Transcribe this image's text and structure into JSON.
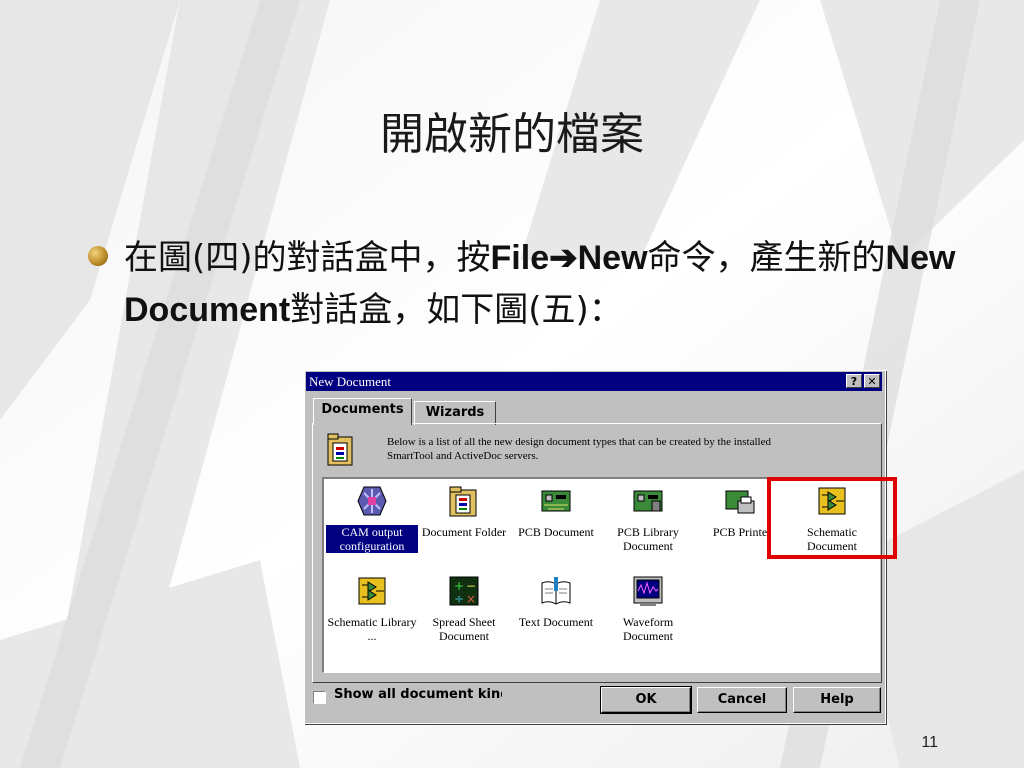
{
  "slide": {
    "title": "開啟新的檔案",
    "bullet": {
      "part1": "在圖(",
      "part2": "四",
      "part3": ")的對話盒中，按",
      "file": "File",
      "arrow": "➔",
      "new": "New",
      "part4": "命令，產生新的",
      "newdoc": "New Document",
      "part5": "對話盒，如下圖(",
      "part6": "五",
      "part7": ")："
    },
    "page_number": "11"
  },
  "dialog": {
    "title": "New Document",
    "help_button": "?",
    "close_button": "✕",
    "tabs": [
      "Documents",
      "Wizards"
    ],
    "description": "Below is a list of all the new design document types that can be created by the installed SmartTool and ActiveDoc servers.",
    "items": [
      {
        "label": "CAM output configuration",
        "icon": "cam-output-icon",
        "selected": true
      },
      {
        "label": "Document Folder",
        "icon": "document-folder-icon",
        "selected": false
      },
      {
        "label": "PCB Document",
        "icon": "pcb-document-icon",
        "selected": false
      },
      {
        "label": "PCB Library Document",
        "icon": "pcb-library-icon",
        "selected": false
      },
      {
        "label": "PCB Printe",
        "icon": "pcb-printer-icon",
        "selected": false
      },
      {
        "label": "Schematic Document",
        "icon": "schematic-document-icon",
        "selected": false
      },
      {
        "label": "Schematic Library ...",
        "icon": "schematic-library-icon",
        "selected": false
      },
      {
        "label": "Spread Sheet Document",
        "icon": "spreadsheet-icon",
        "selected": false
      },
      {
        "label": "Text Document",
        "icon": "text-document-icon",
        "selected": false
      },
      {
        "label": "Waveform Document",
        "icon": "waveform-icon",
        "selected": false
      }
    ],
    "checkbox_label": "Show all document kinds",
    "checkbox_checked": false,
    "buttons": {
      "ok": "OK",
      "cancel": "Cancel",
      "help": "Help"
    }
  },
  "colors": {
    "titlebar": "#000080",
    "dialog_face": "#c0c0c0",
    "highlight": "#e00000",
    "bullet": "#b88624"
  }
}
